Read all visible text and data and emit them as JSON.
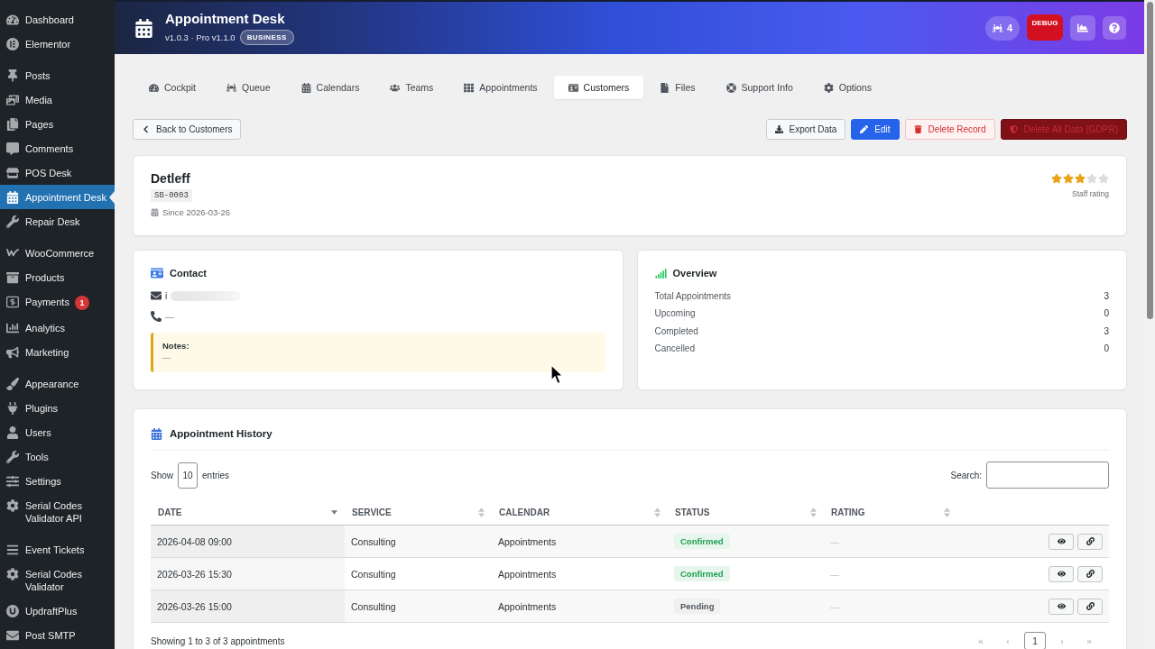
{
  "sidebar": {
    "groups": [
      [
        {
          "label": "Dashboard",
          "selected": false
        },
        {
          "label": "Elementor",
          "selected": false
        }
      ],
      [
        {
          "label": "Posts",
          "selected": false
        },
        {
          "label": "Media",
          "selected": false
        },
        {
          "label": "Pages",
          "selected": false
        },
        {
          "label": "Comments",
          "selected": false
        },
        {
          "label": "POS Desk",
          "selected": false
        },
        {
          "label": "Appointment Desk",
          "selected": true
        },
        {
          "label": "Repair Desk",
          "selected": false
        }
      ],
      [
        {
          "label": "WooCommerce",
          "selected": false
        },
        {
          "label": "Products",
          "selected": false
        },
        {
          "label": "Payments",
          "selected": false,
          "badge": "1"
        },
        {
          "label": "Analytics",
          "selected": false
        },
        {
          "label": "Marketing",
          "selected": false
        }
      ],
      [
        {
          "label": "Appearance",
          "selected": false
        },
        {
          "label": "Plugins",
          "selected": false
        },
        {
          "label": "Users",
          "selected": false
        },
        {
          "label": "Tools",
          "selected": false
        },
        {
          "label": "Settings",
          "selected": false
        },
        {
          "label": "Serial Codes Validator API",
          "selected": false
        }
      ],
      [
        {
          "label": "Event Tickets",
          "selected": false
        },
        {
          "label": "Serial Codes Validator",
          "selected": false
        },
        {
          "label": "UpdraftPlus",
          "selected": false
        },
        {
          "label": "Post SMTP",
          "selected": false
        }
      ]
    ]
  },
  "header": {
    "title": "Appointment Desk",
    "version": "v1.0.3 · Pro v1.1.0",
    "edition": "BUSINESS",
    "counter": "4",
    "debug": "DEBUG"
  },
  "tabs": [
    {
      "label": "Cockpit",
      "selected": false
    },
    {
      "label": "Queue",
      "selected": false
    },
    {
      "label": "Calendars",
      "selected": false
    },
    {
      "label": "Teams",
      "selected": false
    },
    {
      "label": "Appointments",
      "selected": false
    },
    {
      "label": "Customers",
      "selected": true
    },
    {
      "label": "Files",
      "selected": false
    },
    {
      "label": "Support Info",
      "selected": false
    },
    {
      "label": "Options",
      "selected": false
    }
  ],
  "actions": {
    "back": "Back to Customers",
    "buttons": [
      {
        "label": "Export Data",
        "kind": "export"
      },
      {
        "label": "Edit",
        "kind": "primary"
      },
      {
        "label": "Delete Record",
        "kind": "danger"
      },
      {
        "label": "Delete All Data (GDPR)",
        "kind": "gdpr"
      }
    ]
  },
  "customer": {
    "name": "Detleff",
    "code": "SB-0003",
    "since": "Since 2026-03-26",
    "stars": 3,
    "rating_label": "Staff rating"
  },
  "contact": {
    "title": "Contact",
    "email": "i",
    "phone": "—",
    "notes_label": "Notes:",
    "notes": "—"
  },
  "overview": {
    "title": "Overview",
    "rows": [
      {
        "label": "Total Appointments",
        "value": "3"
      },
      {
        "label": "Upcoming",
        "value": "0"
      },
      {
        "label": "Completed",
        "value": "3"
      },
      {
        "label": "Cancelled",
        "value": "0"
      }
    ]
  },
  "history": {
    "title": "Appointment History",
    "show_label": "Show",
    "page_size": "10",
    "entries_label": "entries",
    "search_label": "Search:",
    "columns": [
      {
        "label": "DATE",
        "sorted": true
      },
      {
        "label": "SERVICE",
        "sorted": false
      },
      {
        "label": "CALENDAR",
        "sorted": false
      },
      {
        "label": "STATUS",
        "sorted": false
      },
      {
        "label": "RATING",
        "sorted": false
      }
    ],
    "rows": [
      {
        "date": "2026-04-08 09:00",
        "service": "Consulting",
        "calendar": "Appointments",
        "status": {
          "label": "Confirmed",
          "kind": "confirmed"
        },
        "rating": "—"
      },
      {
        "date": "2026-03-26 15:30",
        "service": "Consulting",
        "calendar": "Appointments",
        "status": {
          "label": "Confirmed",
          "kind": "confirmed"
        },
        "rating": "—"
      },
      {
        "date": "2026-03-26 15:00",
        "service": "Consulting",
        "calendar": "Appointments",
        "status": {
          "label": "Pending",
          "kind": "pending"
        },
        "rating": "—"
      }
    ],
    "info": "Showing 1 to 3 of 3 appointments",
    "pagination": [
      {
        "label": "«",
        "selected": false
      },
      {
        "label": "‹",
        "selected": false
      },
      {
        "label": "1",
        "selected": true
      },
      {
        "label": "›",
        "selected": false
      },
      {
        "label": "»",
        "selected": false
      }
    ]
  }
}
